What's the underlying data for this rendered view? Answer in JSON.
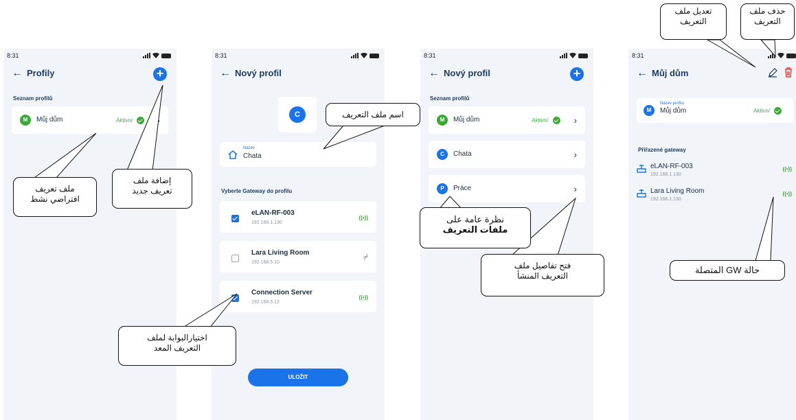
{
  "status_time": "8:31",
  "colors": {
    "accent": "#1a73e8",
    "active": "#3aa935",
    "background": "#f1f4f8"
  },
  "screen1": {
    "title": "Profily",
    "section": "Seznam profilů",
    "profile": {
      "initial": "M",
      "name": "Můj dům",
      "status": "Aktivní"
    }
  },
  "screen2": {
    "title": "Nový profil",
    "avatar_initial": "C",
    "name_label": "Název",
    "name_value": "Chata",
    "gateway_section": "Vyberte Gateway do profilu",
    "gateways": [
      {
        "name": "eLAN-RF-003",
        "ip": "192.168.1.130"
      },
      {
        "name": "Lara Living Room",
        "ip": "192.168.5.10"
      },
      {
        "name": "Connection Server",
        "ip": "192.168.5.12"
      }
    ],
    "save_label": "ULOŽIT"
  },
  "screen3": {
    "title": "Nový profil",
    "section": "Seznam profilů",
    "profiles": [
      {
        "initial": "M",
        "name": "Můj dům",
        "status": "Aktivní"
      },
      {
        "initial": "C",
        "name": "Chata"
      },
      {
        "initial": "P",
        "name": "Práce"
      }
    ]
  },
  "screen4": {
    "title": "Můj dům",
    "name_label": "Název profilu",
    "name_value": "Můj dům",
    "status": "Aktivní",
    "gateway_section": "Přiřazené gateway",
    "gateways": [
      {
        "name": "eLAN-RF-003",
        "ip": "192.168.1.130"
      },
      {
        "name": "Lara Living Room",
        "ip": "192.168.1.130"
      }
    ]
  },
  "callouts": {
    "edit": {
      "line1": "تعديل ملف",
      "line2": "التعريف"
    },
    "delete": {
      "line1": "حذف ملف",
      "line2": "التعريف"
    },
    "profile_name": "اسم ملف التعريف",
    "active_default": {
      "line1": "ملف تعريف",
      "line2": "افتراضي نشط"
    },
    "add_new": {
      "line1": "إضافة ملف",
      "line2": "تعريف جديد"
    },
    "overview": {
      "line1": "نظرة عامة على",
      "line2": "ملفات التعريف"
    },
    "open_details": {
      "line1": "فتح تفاصيل ملف",
      "line2": "التعريف المنشأ"
    },
    "gw_status": "حالة GW المتصلة",
    "select_gateway": {
      "line1": "اختيارالبوابة لملف",
      "line2": "التعريف المعد"
    }
  }
}
